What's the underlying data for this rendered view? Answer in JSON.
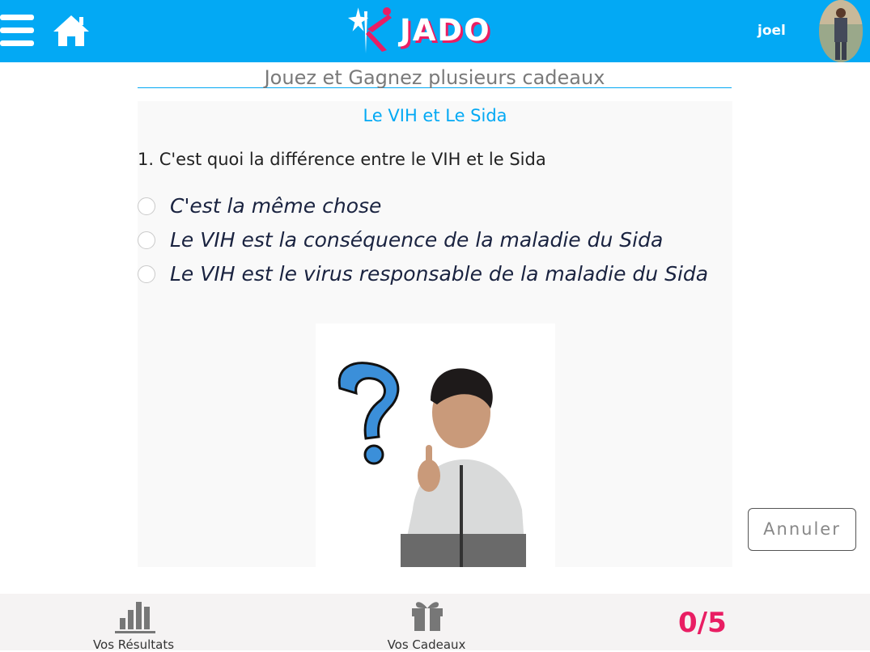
{
  "header": {
    "brand": "JADO",
    "username": "joel",
    "bg_color": "#03a9f4",
    "accent_color": "#e91e63"
  },
  "page": {
    "title": "Jouez et Gagnez plusieurs cadeaux"
  },
  "quiz": {
    "topic": "Le VIH et Le Sida",
    "question": "1. C'est quoi la différence entre le VIH et le Sida",
    "options": [
      "C'est la même chose",
      "Le VIH est la conséquence de la maladie du Sida",
      "Le VIH est le virus responsable de la maladie du Sida"
    ]
  },
  "actions": {
    "cancel_label": "Annuler"
  },
  "bottom_nav": {
    "results_label": "Vos Résultats",
    "gifts_label": "Vos Cadeaux",
    "score": "0/5"
  },
  "icons": {
    "menu": "hamburger-icon",
    "home": "home-icon",
    "results": "bar-chart-icon",
    "gifts": "gift-icon"
  }
}
